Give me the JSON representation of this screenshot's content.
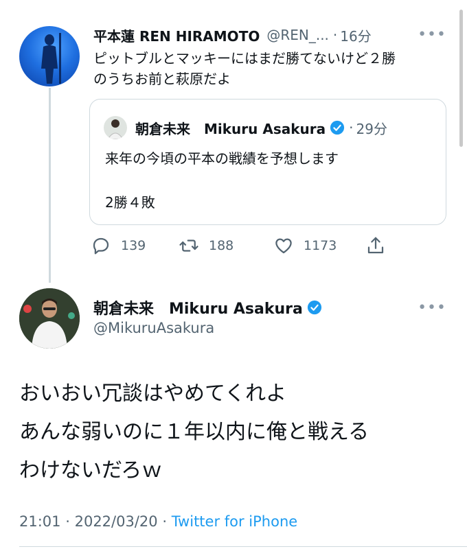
{
  "tweet1": {
    "display_name": "平本蓮 REN HIRAMOTO",
    "handle": "@REN_...",
    "separator": "·",
    "time": "16分",
    "text_line1": "ピットブルとマッキーにはまだ勝てないけど２勝",
    "text_line2": "のうちお前と萩原だよ",
    "more": "•••"
  },
  "quoted": {
    "display_name": "朝倉未来　Mikuru Asakura",
    "separator": "·",
    "time": "29分",
    "text_line1": "来年の今頃の平本の戦績を予想します",
    "text_line2": "2勝４敗"
  },
  "actions": {
    "reply_count": "139",
    "retweet_count": "188",
    "like_count": "1173"
  },
  "tweet2": {
    "display_name": "朝倉未来　Mikuru Asakura",
    "handle": "@MikuruAsakura",
    "more": "•••",
    "text_line1": "おいおい冗談はやめてくれよ",
    "text_line2": "あんな弱いのに１年以内に俺と戦える",
    "text_line3": "わけないだろｗ",
    "time": "21:01",
    "date": "2022/03/20",
    "sep": "·",
    "source": "Twitter for iPhone"
  },
  "colors": {
    "verified": "#1d9bf0",
    "link": "#1d9bf0",
    "muted": "#536471"
  },
  "icons": {
    "reply": "reply-icon",
    "retweet": "retweet-icon",
    "like": "like-icon",
    "share": "share-icon",
    "verified": "verified-badge-icon"
  }
}
